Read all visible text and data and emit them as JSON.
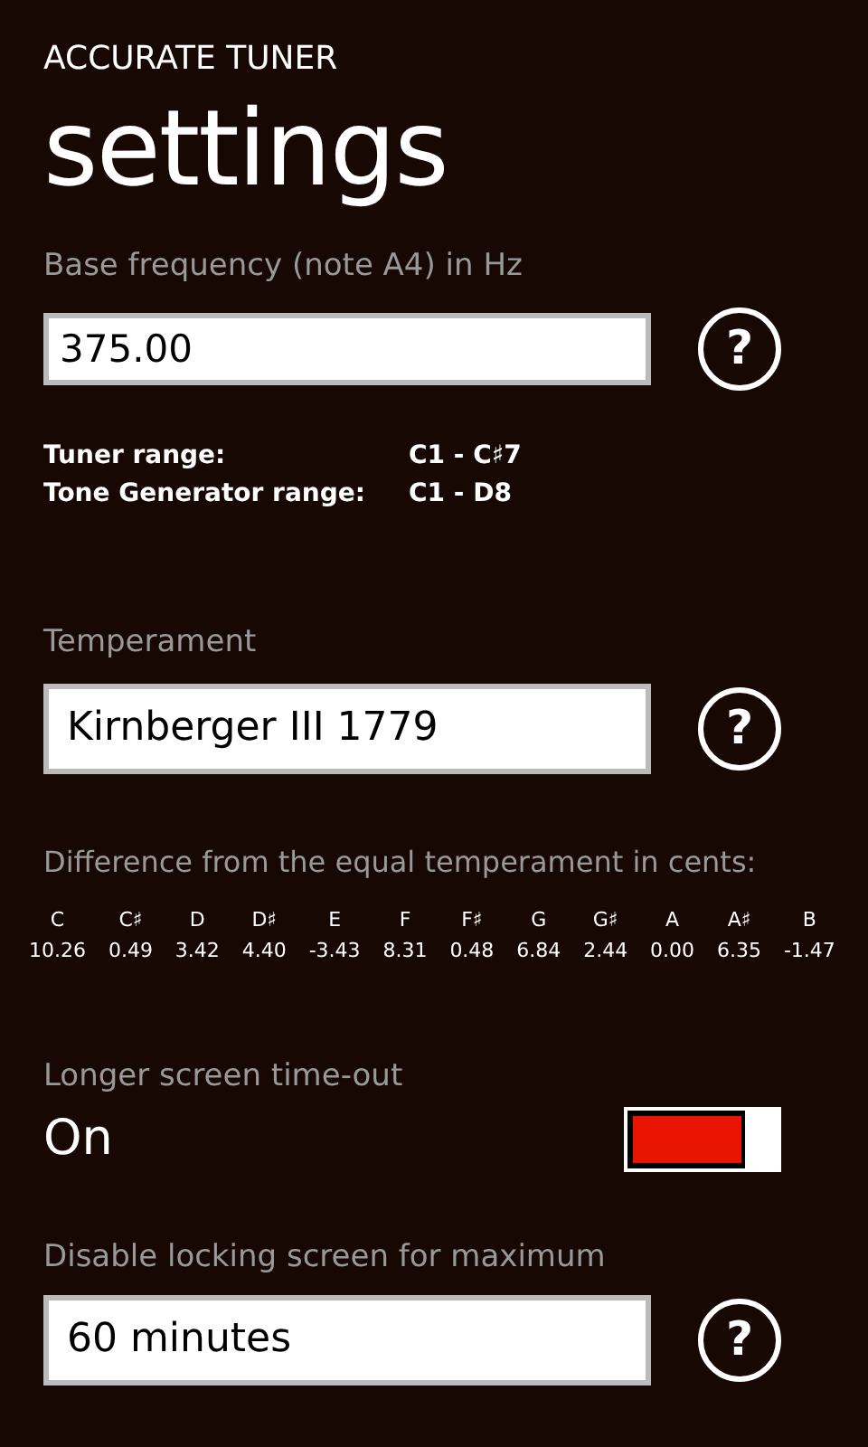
{
  "app_title": "ACCURATE TUNER",
  "page_title": "settings",
  "base_frequency": {
    "label": "Base frequency (note A4) in Hz",
    "value": "375.00",
    "help": "?"
  },
  "ranges": [
    {
      "label": "Tuner range:",
      "value": "C1 - C♯7"
    },
    {
      "label": "Tone Generator range:",
      "value": "C1 - D8"
    }
  ],
  "temperament": {
    "label": "Temperament",
    "value": "Kirnberger III 1779",
    "help": "?"
  },
  "differences": {
    "label": "Difference from the equal temperament in cents:",
    "notes": [
      {
        "note": "C",
        "cents": "10.26"
      },
      {
        "note": "C♯",
        "cents": "0.49"
      },
      {
        "note": "D",
        "cents": "3.42"
      },
      {
        "note": "D♯",
        "cents": "4.40"
      },
      {
        "note": "E",
        "cents": "-3.43"
      },
      {
        "note": "F",
        "cents": "8.31"
      },
      {
        "note": "F♯",
        "cents": "0.48"
      },
      {
        "note": "G",
        "cents": "6.84"
      },
      {
        "note": "G♯",
        "cents": "2.44"
      },
      {
        "note": "A",
        "cents": "0.00"
      },
      {
        "note": "A♯",
        "cents": "6.35"
      },
      {
        "note": "B",
        "cents": "-1.47"
      }
    ]
  },
  "screen_timeout": {
    "label": "Longer screen time-out",
    "state_text": "On",
    "on": true
  },
  "disable_locking": {
    "label": "Disable locking screen for maximum",
    "value": "60 minutes",
    "help": "?"
  }
}
